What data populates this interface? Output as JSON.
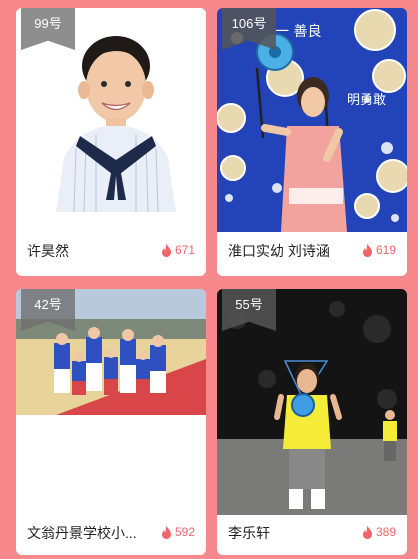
{
  "contestants": [
    {
      "badge": "99号",
      "name": "许昊然",
      "votes": "671"
    },
    {
      "badge": "106号",
      "name": "淮口实幼 刘诗涵",
      "votes": "619"
    },
    {
      "badge": "42号",
      "name": "文翁丹景学校小...",
      "votes": "592"
    },
    {
      "badge": "55号",
      "name": "李乐轩",
      "votes": "389"
    }
  ],
  "colors": {
    "page_background": "#f7888c",
    "card_background": "#ffffff",
    "vote_color": "#f0646a"
  },
  "icons": {
    "vote": "flame-icon"
  }
}
